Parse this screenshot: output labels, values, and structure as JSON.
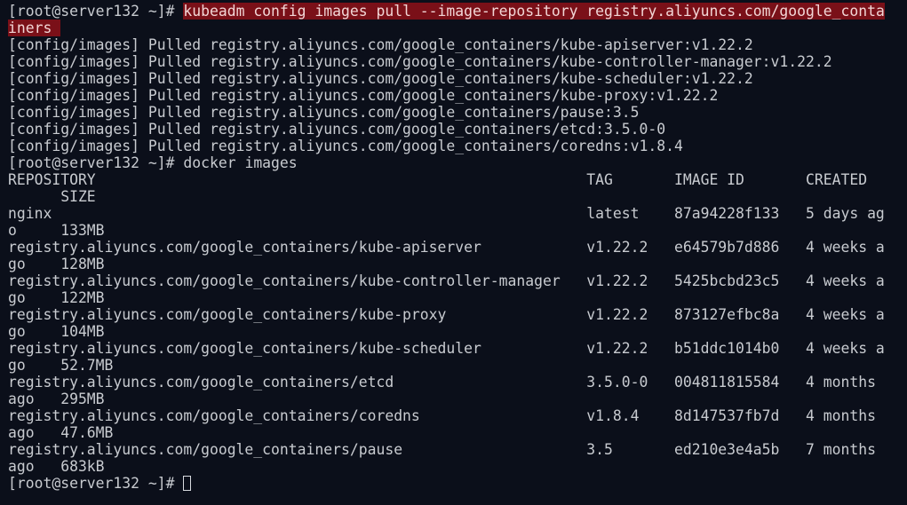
{
  "terminal": {
    "prompt": "[root@server132 ~]# ",
    "command1_part1": "kubeadm config images pull --image-repository registry.aliyuncs.com/google_conta",
    "command1_part2": "iners ",
    "pulled": [
      "[config/images] Pulled registry.aliyuncs.com/google_containers/kube-apiserver:v1.22.2",
      "[config/images] Pulled registry.aliyuncs.com/google_containers/kube-controller-manager:v1.22.2",
      "[config/images] Pulled registry.aliyuncs.com/google_containers/kube-scheduler:v1.22.2",
      "[config/images] Pulled registry.aliyuncs.com/google_containers/kube-proxy:v1.22.2",
      "[config/images] Pulled registry.aliyuncs.com/google_containers/pause:3.5",
      "[config/images] Pulled registry.aliyuncs.com/google_containers/etcd:3.5.0-0",
      "[config/images] Pulled registry.aliyuncs.com/google_containers/coredns:v1.8.4"
    ],
    "command2": "docker images",
    "table_lines": [
      "REPOSITORY                                                        TAG       IMAGE ID       CREATED",
      "      SIZE",
      "nginx                                                             latest    87a94228f133   5 days ag",
      "o     133MB",
      "registry.aliyuncs.com/google_containers/kube-apiserver            v1.22.2   e64579b7d886   4 weeks a",
      "go    128MB",
      "registry.aliyuncs.com/google_containers/kube-controller-manager   v1.22.2   5425bcbd23c5   4 weeks a",
      "go    122MB",
      "registry.aliyuncs.com/google_containers/kube-proxy                v1.22.2   873127efbc8a   4 weeks a",
      "go    104MB",
      "registry.aliyuncs.com/google_containers/kube-scheduler            v1.22.2   b51ddc1014b0   4 weeks a",
      "go    52.7MB",
      "registry.aliyuncs.com/google_containers/etcd                      3.5.0-0   004811815584   4 months",
      "ago   295MB",
      "registry.aliyuncs.com/google_containers/coredns                   v1.8.4    8d147537fb7d   4 months",
      "ago   47.6MB",
      "registry.aliyuncs.com/google_containers/pause                     3.5       ed210e3e4a5b   7 months",
      "ago   683kB"
    ],
    "final_prompt": "[root@server132 ~]# "
  }
}
